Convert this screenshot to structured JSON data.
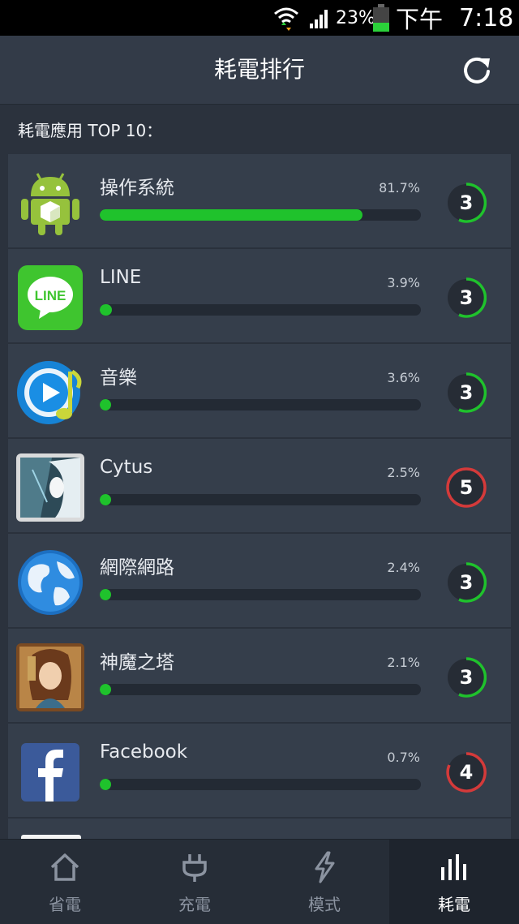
{
  "status_bar": {
    "battery_percent": "23%",
    "am_pm": "下午",
    "time": "7:18"
  },
  "header": {
    "title": "耗電排行"
  },
  "section": {
    "label": "耗電應用 TOP 10："
  },
  "apps": [
    {
      "name": "操作系統",
      "percent": "81.7%",
      "usage_fraction": 0.817,
      "score": "3",
      "ring_color": "#1fc22c",
      "icon": "android-icon"
    },
    {
      "name": "LINE",
      "percent": "3.9%",
      "usage_fraction": 0.039,
      "score": "3",
      "ring_color": "#1fc22c",
      "icon": "line-app-icon",
      "icon_text": "LINE"
    },
    {
      "name": "音樂",
      "percent": "3.6%",
      "usage_fraction": 0.036,
      "score": "3",
      "ring_color": "#1fc22c",
      "icon": "music-player-icon"
    },
    {
      "name": "Cytus",
      "percent": "2.5%",
      "usage_fraction": 0.025,
      "score": "5",
      "ring_color": "#d43a3a",
      "icon": "cytus-app-icon"
    },
    {
      "name": "網際網路",
      "percent": "2.4%",
      "usage_fraction": 0.024,
      "score": "3",
      "ring_color": "#1fc22c",
      "icon": "globe-icon"
    },
    {
      "name": "神魔之塔",
      "percent": "2.1%",
      "usage_fraction": 0.021,
      "score": "3",
      "ring_color": "#1fc22c",
      "icon": "tower-of-saviors-icon"
    },
    {
      "name": "Facebook",
      "percent": "0.7%",
      "usage_fraction": 0.007,
      "score": "4",
      "ring_color": "#d43a3a",
      "icon": "facebook-icon"
    }
  ],
  "nav": [
    {
      "label": "省電",
      "icon": "home-icon"
    },
    {
      "label": "充電",
      "icon": "plug-icon"
    },
    {
      "label": "模式",
      "icon": "lightning-icon"
    },
    {
      "label": "耗電",
      "icon": "bar-chart-icon",
      "active": true
    }
  ]
}
